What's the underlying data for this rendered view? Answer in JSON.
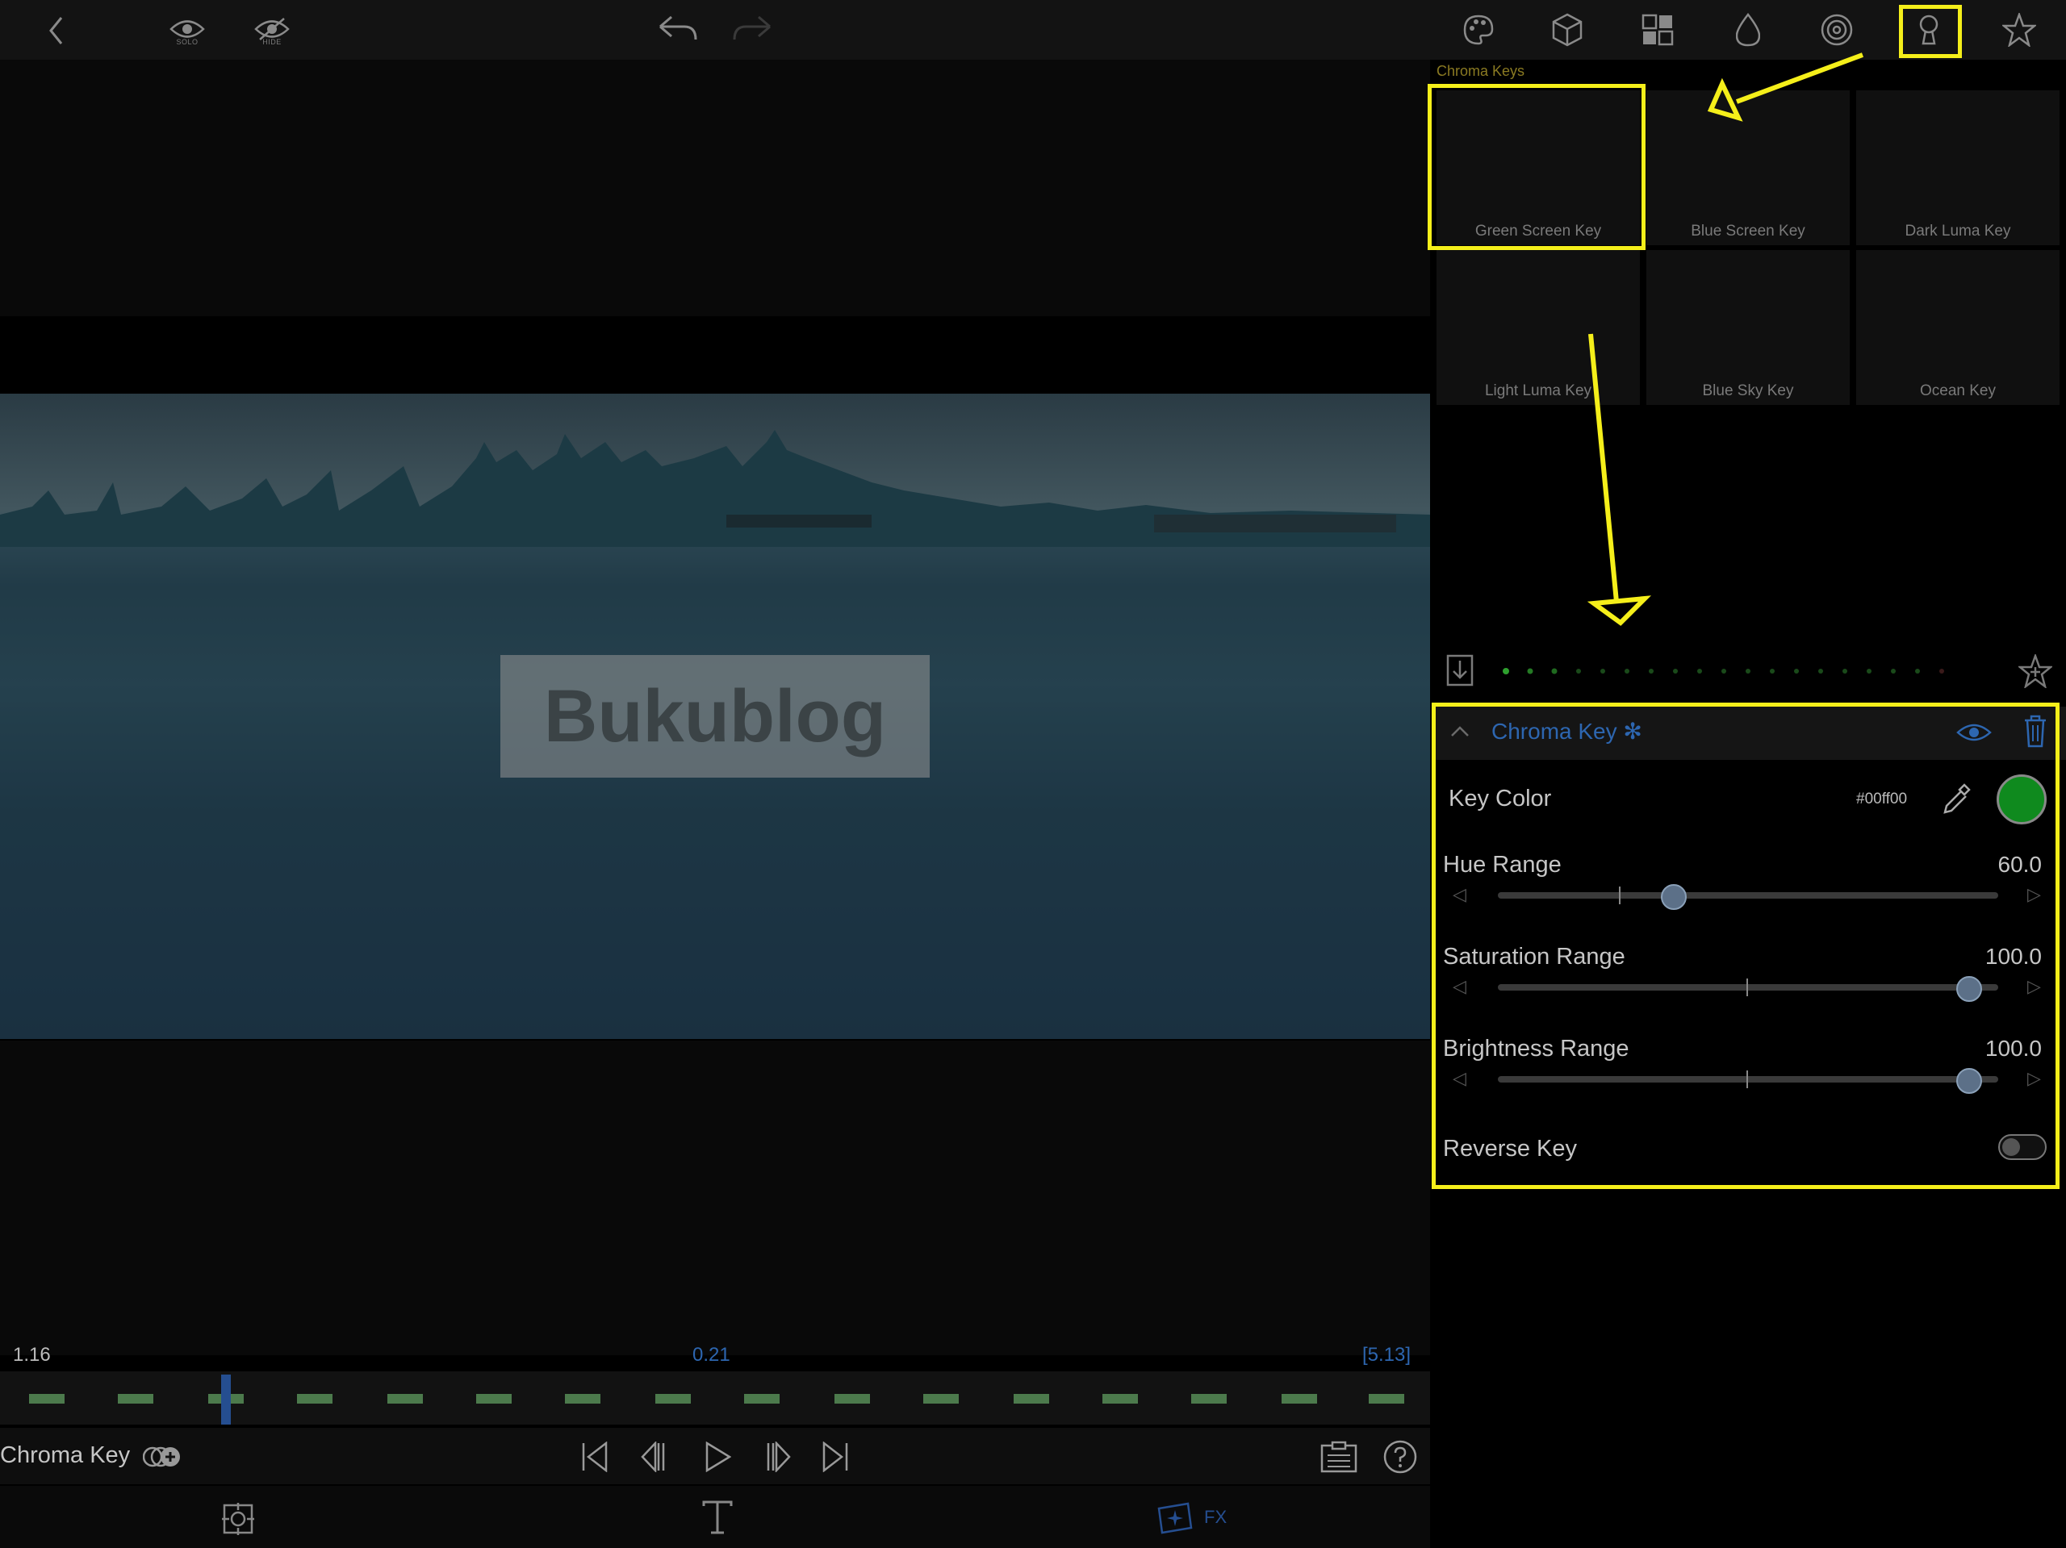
{
  "topbar": {
    "solo_label": "SOLO",
    "hide_label": "HIDE"
  },
  "library": {
    "section_title": "Chroma Keys",
    "presets": [
      {
        "label": "Green Screen Key"
      },
      {
        "label": "Blue Screen Key"
      },
      {
        "label": "Dark Luma Key"
      },
      {
        "label": "Light Luma Key"
      },
      {
        "label": "Blue Sky Key"
      },
      {
        "label": "Ocean Key"
      }
    ]
  },
  "viewer": {
    "watermark": "Bukublog"
  },
  "key_panel": {
    "title": "Chroma Key ✻",
    "key_color_label": "Key Color",
    "key_color_hex": "#00ff00",
    "key_color_swatch": "#0f8a1e",
    "params": [
      {
        "label": "Hue Range",
        "value": "60.0",
        "fraction": 0.36
      },
      {
        "label": "Saturation Range",
        "value": "100.0",
        "fraction": 1.0
      },
      {
        "label": "Brightness Range",
        "value": "100.0",
        "fraction": 1.0
      }
    ],
    "reverse_label": "Reverse Key",
    "reverse_on": false
  },
  "timeline": {
    "time_left": "1.16",
    "time_center": "0.21",
    "time_right": "[5.13]"
  },
  "controls": {
    "clip_name": "Chroma Key"
  },
  "tabs": {
    "fx_label": "FX"
  },
  "colors": {
    "highlight": "#f5ef1a",
    "accent": "#2d66b0"
  }
}
